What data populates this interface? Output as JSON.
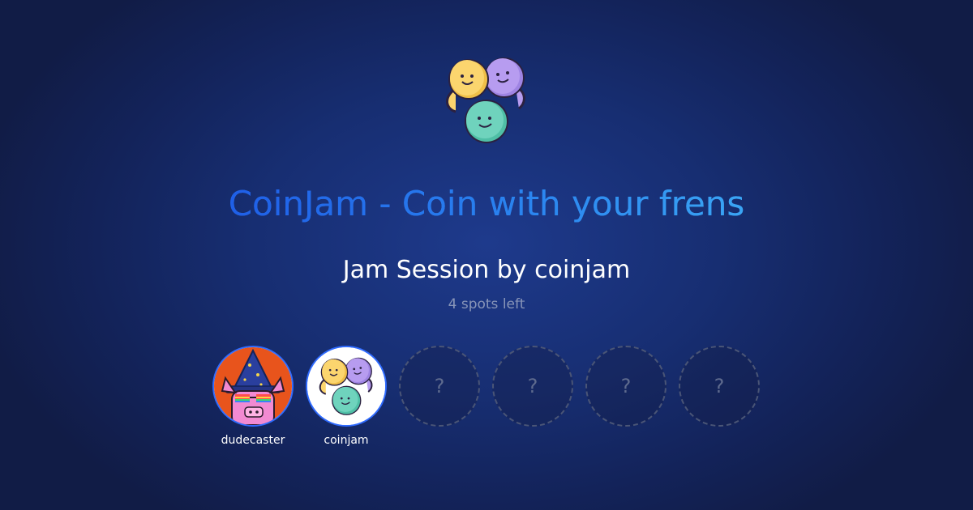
{
  "header": {
    "logo_icon": "coin-trio-logo-icon",
    "headline": "CoinJam - Coin with your frens"
  },
  "session": {
    "title": "Jam Session by coinjam",
    "spots_left": "4 spots left"
  },
  "participants": [
    {
      "name": "dudecaster",
      "avatar_icon": "wizard-pig-avatar-icon"
    },
    {
      "name": "coinjam",
      "avatar_icon": "coin-trio-avatar-icon"
    }
  ],
  "open_slots": [
    {
      "label": "?"
    },
    {
      "label": "?"
    },
    {
      "label": "?"
    },
    {
      "label": "?"
    }
  ],
  "colors": {
    "background": "#172e72",
    "headline_start": "#1f5fe8",
    "headline_end": "#3aa5f4",
    "avatar_ring": "#2f6bff",
    "muted_text": "#8895b8",
    "coin_yellow": "#fbd56e",
    "coin_purple": "#b79cf0",
    "coin_teal": "#6fd3bd"
  }
}
